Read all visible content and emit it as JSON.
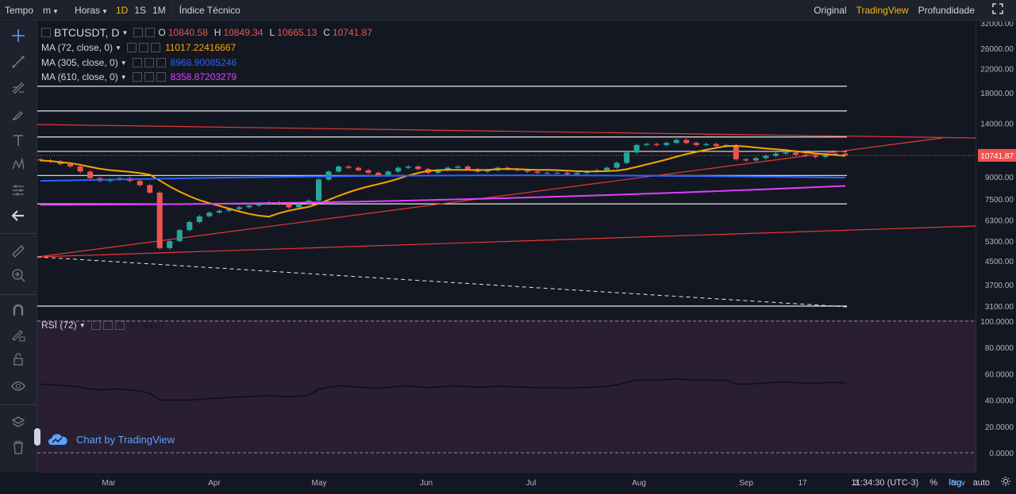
{
  "toolbar": {
    "tempo_label": "Tempo",
    "unit_value": "m",
    "hours_label": "Horas",
    "intervals": [
      {
        "label": "1D",
        "active": true
      },
      {
        "label": "1S",
        "active": false
      },
      {
        "label": "1M",
        "active": false
      }
    ],
    "indicators_label": "Índice Técnico",
    "views": [
      {
        "label": "Original",
        "active": false
      },
      {
        "label": "TradingView",
        "active": true
      },
      {
        "label": "Profundidade",
        "active": false
      }
    ],
    "fullscreen_icon": "fullscreen-icon"
  },
  "sidebar": {
    "tools": [
      "crosshair-icon",
      "trendline-icon",
      "fib-icon",
      "brush-icon",
      "text-icon",
      "pattern-icon",
      "prediction-icon",
      "back-arrow-icon",
      "ruler-icon",
      "zoom-in-icon",
      "magnet-icon",
      "lock-drawing-icon",
      "lock-icon",
      "eye-icon",
      "layers-icon",
      "trash-icon"
    ]
  },
  "legend": {
    "symbol": "BTCUSDT, D",
    "ohlc": [
      {
        "label": "O",
        "value": "10840.58"
      },
      {
        "label": "H",
        "value": "10849.34"
      },
      {
        "label": "L",
        "value": "10665.13"
      },
      {
        "label": "C",
        "value": "10741.87"
      }
    ],
    "studies": [
      {
        "name": "MA (72, close, 0)",
        "value": "11017.22416667",
        "color": "#f7a600"
      },
      {
        "name": "MA (305, close, 0)",
        "value": "8968.90085246",
        "color": "#2962ff"
      },
      {
        "name": "MA (610, close, 0)",
        "value": "8358.87203279",
        "color": "#e040fb"
      }
    ],
    "rsi": {
      "name": "RSI (72)",
      "value": "51.9950"
    }
  },
  "watermark": "Chart by TradingView",
  "price_axis": {
    "labels": [
      "32000.00",
      "26000.00",
      "22000.00",
      "18000.00",
      "14000.00",
      "9000.00",
      "7500.00",
      "6300.00",
      "5300.00",
      "4500.00",
      "3700.00",
      "3100.00"
    ],
    "current": "10741.87",
    "rsi_labels": [
      "100.0000",
      "80.0000",
      "60.0000",
      "40.0000",
      "20.0000",
      "0.0000"
    ]
  },
  "time_axis": {
    "labels": [
      "Mar",
      "Apr",
      "May",
      "Jun",
      "Jul",
      "Aug",
      "Sep",
      "17",
      "3",
      "Nov"
    ]
  },
  "status": {
    "clock": "11:34:30 (UTC-3)",
    "percent": "%",
    "log": "log",
    "auto": "auto",
    "settings_icon": "settings-icon"
  },
  "colors": {
    "up": "#26a69a",
    "down": "#ef5350",
    "trend": "#e53935",
    "rsi_bg": "#2a1e33",
    "accent": "#f0b90b"
  },
  "chart_data": {
    "type": "candlestick",
    "symbol": "BTCUSDT",
    "interval": "D",
    "scale": "log",
    "x_labels": [
      "Mar",
      "Apr",
      "May",
      "Jun",
      "Jul",
      "Aug",
      "Sep",
      "17",
      "3",
      "Nov"
    ],
    "y_ticks": [
      3100,
      3700,
      4500,
      5300,
      6300,
      7500,
      9000,
      14000,
      18000,
      22000,
      26000,
      32000
    ],
    "close_series": [
      10300,
      10200,
      10000,
      9800,
      9400,
      8900,
      8700,
      8800,
      8900,
      8700,
      8400,
      7900,
      5000,
      5300,
      5800,
      6200,
      6500,
      6700,
      6800,
      6900,
      7000,
      7100,
      7200,
      7300,
      7200,
      7000,
      7200,
      7400,
      8800,
      9400,
      9800,
      9700,
      9500,
      9300,
      9100,
      9400,
      9700,
      9800,
      9600,
      9300,
      9500,
      9700,
      9800,
      9600,
      9400,
      9500,
      9700,
      9600,
      9500,
      9400,
      9300,
      9300,
      9300,
      9200,
      9300,
      9400,
      9500,
      9700,
      10100,
      11000,
      11700,
      11800,
      11700,
      11900,
      12200,
      11900,
      11700,
      11800,
      11600,
      11700,
      10400,
      10300,
      10500,
      10700,
      10900,
      11000,
      10800,
      10700,
      10600,
      10800,
      10900,
      10750
    ],
    "moving_averages": [
      {
        "name": "MA (72, close, 0)",
        "last": 11017.22416667
      },
      {
        "name": "MA (305, close, 0)",
        "last": 8968.90085246
      },
      {
        "name": "MA (610, close, 0)",
        "last": 8358.87203279
      }
    ],
    "horizontal_levels": [
      19000,
      15500,
      12500,
      11100,
      9100,
      7200,
      3100
    ],
    "rsi": {
      "period": 72,
      "last": 51.995,
      "range": [
        0,
        100
      ]
    }
  }
}
